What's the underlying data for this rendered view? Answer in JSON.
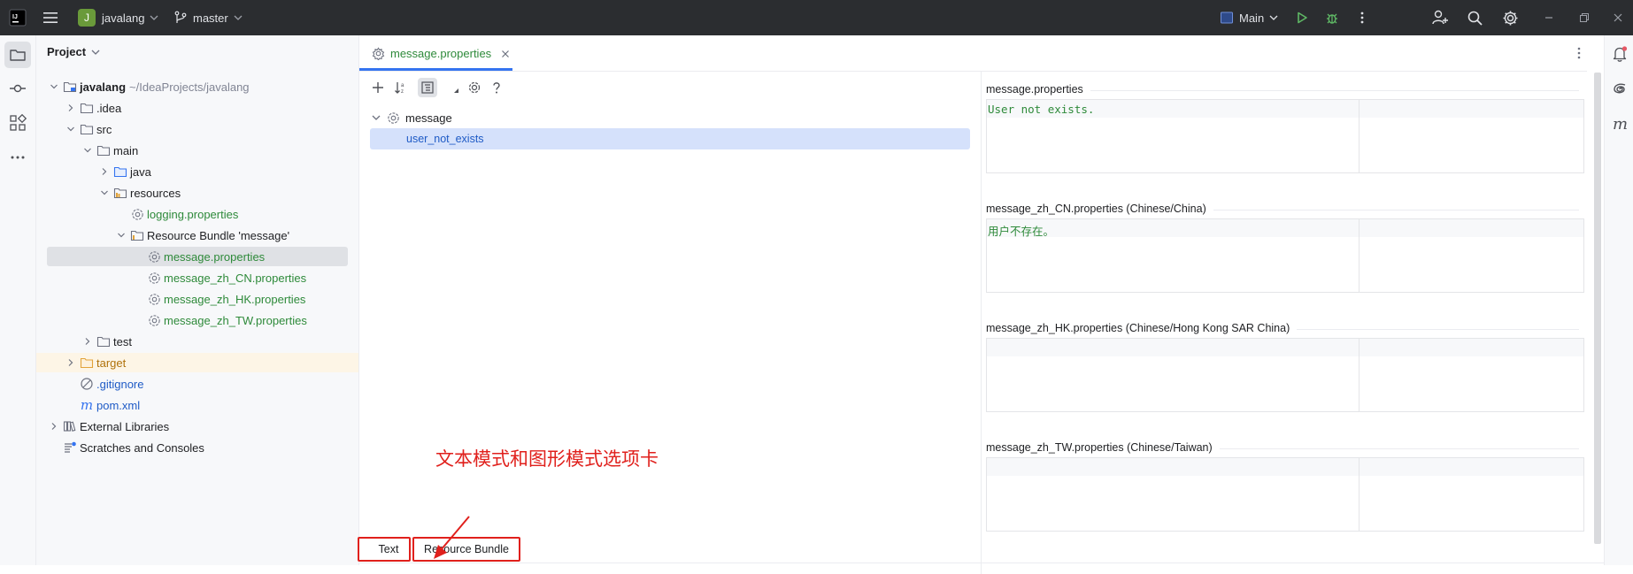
{
  "titlebar": {
    "project_badge": "J",
    "project_name": "javalang",
    "branch": "master",
    "run_config": "Main",
    "colors": {
      "bg": "#2b2d30",
      "badge": "#6a9a3a",
      "run": "#5fb865"
    }
  },
  "left_strip": {
    "icons": [
      "folder-icon",
      "commit-icon",
      "structure-icon",
      "more-icon"
    ]
  },
  "project_panel": {
    "title": "Project",
    "tree": [
      {
        "label": "javalang",
        "suffix": "~/IdeaProjects/javalang",
        "icon": "module-folder",
        "chevron": "down",
        "color": "default",
        "indent": 0
      },
      {
        "label": ".idea",
        "icon": "folder",
        "chevron": "right",
        "color": "default",
        "indent": 1
      },
      {
        "label": "src",
        "icon": "folder",
        "chevron": "down",
        "color": "default",
        "indent": 1
      },
      {
        "label": "main",
        "icon": "folder",
        "chevron": "down",
        "color": "default",
        "indent": 2
      },
      {
        "label": "java",
        "icon": "folder-blue",
        "chevron": "right",
        "color": "default",
        "indent": 3
      },
      {
        "label": "resources",
        "icon": "folder-resources",
        "chevron": "down",
        "color": "default",
        "indent": 3
      },
      {
        "label": "logging.properties",
        "icon": "properties",
        "chevron": "none",
        "color": "green",
        "indent": 4
      },
      {
        "label": "Resource Bundle 'message'",
        "icon": "bundle",
        "chevron": "down",
        "color": "default",
        "indent": 4
      },
      {
        "label": "message.properties",
        "icon": "properties",
        "chevron": "none",
        "color": "green",
        "indent": 5,
        "selected": true
      },
      {
        "label": "message_zh_CN.properties",
        "icon": "properties",
        "chevron": "none",
        "color": "green",
        "indent": 5
      },
      {
        "label": "message_zh_HK.properties",
        "icon": "properties",
        "chevron": "none",
        "color": "green",
        "indent": 5
      },
      {
        "label": "message_zh_TW.properties",
        "icon": "properties",
        "chevron": "none",
        "color": "green",
        "indent": 5
      },
      {
        "label": "test",
        "icon": "folder",
        "chevron": "right",
        "color": "default",
        "indent": 2
      },
      {
        "label": "target",
        "icon": "folder-orange",
        "chevron": "right",
        "color": "orange",
        "indent": 1,
        "highlight": true
      },
      {
        "label": ".gitignore",
        "icon": "ignore",
        "chevron": "none",
        "color": "blue",
        "indent": 1
      },
      {
        "label": "pom.xml",
        "icon": "maven",
        "chevron": "none",
        "color": "blue",
        "indent": 1
      },
      {
        "label": "External Libraries",
        "icon": "libraries",
        "chevron": "right",
        "color": "default",
        "indent": 0
      },
      {
        "label": "Scratches and Consoles",
        "icon": "scratches",
        "chevron": "none",
        "color": "default",
        "indent": 0
      }
    ]
  },
  "editor": {
    "tab": {
      "label": "message.properties"
    },
    "bundle_tree": {
      "root": "message",
      "keys": [
        "user_not_exists"
      ]
    },
    "panes": [
      {
        "title": "message.properties",
        "value": "User not exists."
      },
      {
        "title": "message_zh_CN.properties (Chinese/China)",
        "value": "用户不存在。"
      },
      {
        "title": "message_zh_HK.properties (Chinese/Hong Kong SAR China)",
        "value": ""
      },
      {
        "title": "message_zh_TW.properties (Chinese/Taiwan)",
        "value": ""
      }
    ],
    "bottom_tabs": {
      "text": "Text",
      "bundle": "Resource Bundle"
    },
    "annotation": "文本模式和图形模式选项卡",
    "annotation_color": "#e0201c"
  }
}
